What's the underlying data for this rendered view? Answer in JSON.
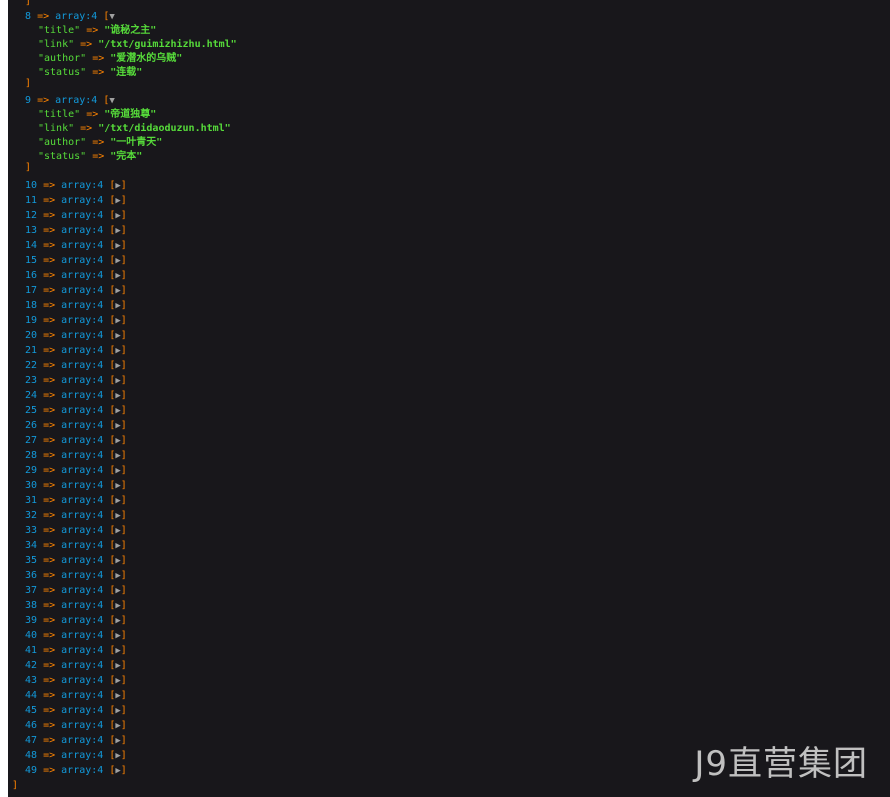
{
  "dump": {
    "open_close": "]",
    "arrow": "=>",
    "array_type": "array:4",
    "expanded_toggle": "▼",
    "collapsed_toggle": "▶",
    "bracket_open": "[",
    "bracket_close": "]",
    "expanded_items": [
      {
        "index": "8",
        "fields": [
          {
            "key": "\"title\"",
            "value": "\"诡秘之主\""
          },
          {
            "key": "\"link\"",
            "value": "\"/txt/guimizhizhu.html\""
          },
          {
            "key": "\"author\"",
            "value": "\"爱潜水的乌贼\""
          },
          {
            "key": "\"status\"",
            "value": "\"连载\""
          }
        ]
      },
      {
        "index": "9",
        "fields": [
          {
            "key": "\"title\"",
            "value": "\"帝道独尊\""
          },
          {
            "key": "\"link\"",
            "value": "\"/txt/didaoduzun.html\""
          },
          {
            "key": "\"author\"",
            "value": "\"一叶青天\""
          },
          {
            "key": "\"status\"",
            "value": "\"完本\""
          }
        ]
      }
    ],
    "collapsed_indices": [
      "10",
      "11",
      "12",
      "13",
      "14",
      "15",
      "16",
      "17",
      "18",
      "19",
      "20",
      "21",
      "22",
      "23",
      "24",
      "25",
      "26",
      "27",
      "28",
      "29",
      "30",
      "31",
      "32",
      "33",
      "34",
      "35",
      "36",
      "37",
      "38",
      "39",
      "40",
      "41",
      "42",
      "43",
      "44",
      "45",
      "46",
      "47",
      "48",
      "49"
    ],
    "final_close": "]"
  },
  "watermark": "J9直营集团",
  "colors": {
    "background": "#18171b",
    "bracket": "#ff8400",
    "index": "#1299da",
    "string": "#56db3a"
  }
}
